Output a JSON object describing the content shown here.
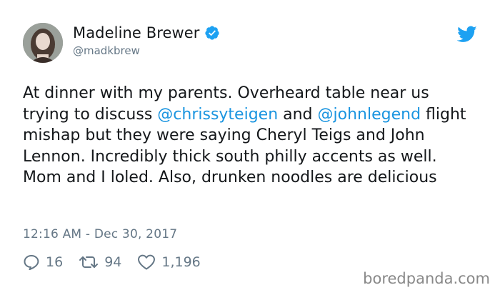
{
  "author": {
    "display_name": "Madeline Brewer",
    "handle": "@madkbrew"
  },
  "tweet": {
    "segments": [
      {
        "text": "At dinner with my parents. Overheard table near us trying to discuss ",
        "type": "text"
      },
      {
        "text": "@chrissyteigen",
        "type": "mention"
      },
      {
        "text": " and ",
        "type": "text"
      },
      {
        "text": "@johnlegend",
        "type": "mention"
      },
      {
        "text": " flight mishap but they were saying Cheryl Teigs and John Lennon. Incredibly thick south philly accents as well. Mom and I loled. Also, drunken noodles are delicious",
        "type": "text"
      }
    ],
    "timestamp": "12:16 AM - Dec 30, 2017"
  },
  "stats": {
    "replies": "16",
    "retweets": "94",
    "likes": "1,196"
  },
  "icons": {
    "verified": "verified-badge-icon",
    "brand": "twitter-bird-icon",
    "reply": "reply-icon",
    "retweet": "retweet-icon",
    "like": "heart-icon"
  },
  "colors": {
    "mention": "#1b95e0",
    "twitter_blue": "#1da1f2",
    "muted": "#657786"
  },
  "watermark": "boredpanda.com"
}
